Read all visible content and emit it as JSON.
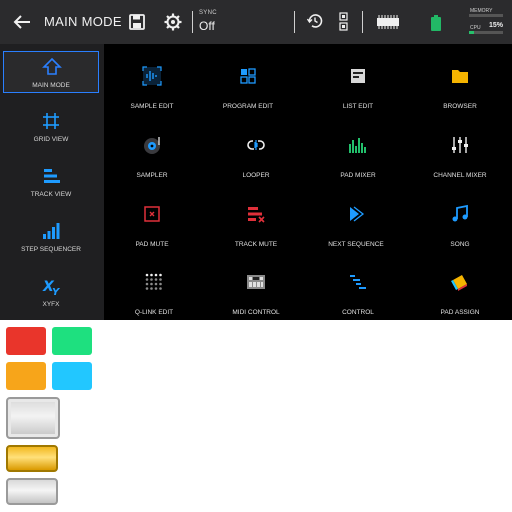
{
  "header": {
    "title": "MAIN MODE",
    "sync_label": "SYNC",
    "sync_value": "Off",
    "memory_label": "MEMORY",
    "cpu_label": "CPU",
    "cpu_value": "15%",
    "cpu_fraction": 0.15
  },
  "sidebar": {
    "items": [
      {
        "label": "MAIN MODE",
        "icon": "home-icon",
        "active": true
      },
      {
        "label": "GRID VIEW",
        "icon": "grid-view-icon",
        "active": false
      },
      {
        "label": "TRACK VIEW",
        "icon": "track-view-icon",
        "active": false
      },
      {
        "label": "STEP SEQUENCER",
        "icon": "step-sequencer-icon",
        "active": false
      },
      {
        "label": "XYFX",
        "icon": "xyfx-icon",
        "active": false
      }
    ]
  },
  "tiles": [
    {
      "label": "SAMPLE EDIT",
      "icon": "sample-edit-icon",
      "color": "#1e9bff"
    },
    {
      "label": "PROGRAM EDIT",
      "icon": "program-edit-icon",
      "color": "#1e9bff"
    },
    {
      "label": "LIST EDIT",
      "icon": "list-edit-icon",
      "color": "#d8d8d8"
    },
    {
      "label": "BROWSER",
      "icon": "folder-icon",
      "color": "#f5b400"
    },
    {
      "label": "SAMPLER",
      "icon": "sampler-icon",
      "color": "#1e9bff"
    },
    {
      "label": "LOOPER",
      "icon": "looper-icon",
      "color": "#ffffff"
    },
    {
      "label": "PAD MIXER",
      "icon": "pad-mixer-icon",
      "color": "#22c06b"
    },
    {
      "label": "CHANNEL MIXER",
      "icon": "channel-mixer-icon",
      "color": "#ffffff"
    },
    {
      "label": "PAD MUTE",
      "icon": "pad-mute-icon",
      "color": "#e0303a"
    },
    {
      "label": "TRACK MUTE",
      "icon": "track-mute-icon",
      "color": "#e0303a"
    },
    {
      "label": "NEXT SEQUENCE",
      "icon": "next-sequence-icon",
      "color": "#1e9bff"
    },
    {
      "label": "SONG",
      "icon": "song-icon",
      "color": "#1e9bff"
    },
    {
      "label": "Q-LINK EDIT",
      "icon": "q-link-edit-icon",
      "color": "#d8d8d8"
    },
    {
      "label": "MIDI CONTROL",
      "icon": "midi-control-icon",
      "color": "#d8d8d8"
    },
    {
      "label": "CONTROL",
      "icon": "control-icon",
      "color": "#1e9bff"
    },
    {
      "label": "PAD ASSIGN",
      "icon": "pad-assign-icon",
      "color": "#f5b400"
    }
  ],
  "swatches": [
    "#e9352b",
    "#1ee07f",
    "#f7a51a",
    "#22c7ff"
  ],
  "colors": {
    "accent": "#2a7fff",
    "topbar": "#2b2b2d",
    "battery": "#22b866"
  }
}
